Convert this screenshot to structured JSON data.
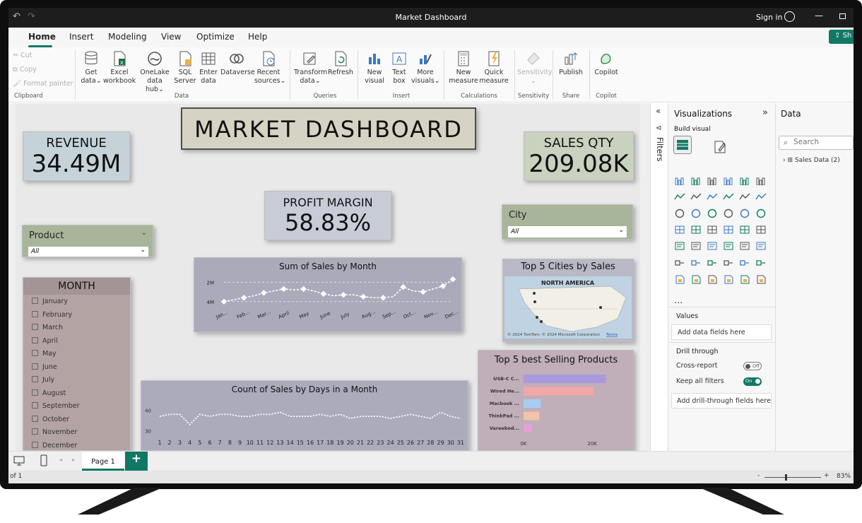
{
  "window": {
    "title": "Market Dashboard",
    "sign_in": "Sign in"
  },
  "menu": [
    "Home",
    "Insert",
    "Modeling",
    "View",
    "Optimize",
    "Help"
  ],
  "share_label": "Sh",
  "clipboard": {
    "cut": "Cut",
    "copy": "Copy",
    "format_painter": "Format painter",
    "group": "Clipboard"
  },
  "ribbon": {
    "get_data_1": "Get",
    "get_data_2": "data",
    "excel_1": "Excel",
    "excel_2": "workbook",
    "onelake_1": "OneLake",
    "onelake_2": "data hub",
    "sql_1": "SQL",
    "sql_2": "Server",
    "enter_1": "Enter",
    "enter_2": "data",
    "dataverse": "Dataverse",
    "recent_1": "Recent",
    "recent_2": "sources",
    "data_group": "Data",
    "transform_1": "Transform",
    "transform_2": "data",
    "refresh": "Refresh",
    "queries_group": "Queries",
    "new_visual_1": "New",
    "new_visual_2": "visual",
    "text_box_1": "Text",
    "text_box_2": "box",
    "more_visuals_1": "More",
    "more_visuals_2": "visuals",
    "insert_group": "Insert",
    "new_measure_1": "New",
    "new_measure_2": "measure",
    "quick_measure_1": "Quick",
    "quick_measure_2": "measure",
    "calculations_group": "Calculations",
    "sensitivity": "Sensitivity",
    "sensitivity_group": "Sensitivity",
    "publish": "Publish",
    "share_group": "Share",
    "copilot": "Copilot",
    "copilot_group": "Copilot"
  },
  "dashboard": {
    "title": "MARKET DASHBOARD",
    "revenue_label": "REVENUE",
    "revenue_value": "34.49M",
    "sales_qty_label": "SALES QTY",
    "sales_qty_value": "209.08K",
    "profit_label": "PROFIT MARGIN",
    "profit_value": "58.83%",
    "product_label": "Product",
    "product_value": "All",
    "city_label": "City",
    "city_value": "All",
    "month_label": "MONTH",
    "months": [
      "January",
      "February",
      "March",
      "April",
      "May",
      "June",
      "July",
      "August",
      "September",
      "October",
      "November",
      "December"
    ],
    "map_title": "Top 5 Cities by Sales",
    "map_region": "NORTH AMERICA",
    "map_credit": "© 2024 TomTom, © 2024 Microsoft Corporation",
    "map_terms": "Terms"
  },
  "chart_data": [
    {
      "type": "line",
      "title": "Sum of Sales by Month",
      "categories": [
        "Jan...",
        "Feb...",
        "Mar...",
        "April",
        "May",
        "June",
        "July",
        "Aug...",
        "Sep...",
        "Oct...",
        "Nov...",
        "Dec..."
      ],
      "x": [
        1,
        2,
        3,
        4,
        5,
        6,
        7,
        8,
        9,
        10,
        11,
        12,
        13,
        14,
        15,
        16,
        17,
        18,
        19,
        20,
        21,
        22,
        23,
        24
      ],
      "values": [
        2.0,
        2.2,
        2.4,
        2.6,
        2.9,
        3.1,
        3.3,
        3.2,
        3.3,
        3.1,
        2.8,
        2.6,
        2.7,
        2.7,
        2.5,
        2.4,
        2.4,
        2.5,
        3.5,
        3.1,
        3.0,
        3.3,
        3.6,
        4.3
      ],
      "yticks": [
        "2M",
        "4M"
      ],
      "ylim": [
        1.4,
        4.6
      ]
    },
    {
      "type": "line",
      "title": "Count of Sales by Days in a Month",
      "x": [
        1,
        2,
        3,
        4,
        5,
        6,
        7,
        8,
        9,
        10,
        11,
        12,
        13,
        14,
        15,
        16,
        17,
        18,
        19,
        20,
        21,
        22,
        23,
        24,
        25,
        26,
        27,
        28,
        29,
        30,
        31
      ],
      "values": [
        37,
        38,
        38,
        33,
        38,
        37,
        38,
        38,
        37,
        37,
        38,
        38,
        39,
        37,
        37,
        37,
        38,
        37,
        38,
        36,
        37,
        37,
        37,
        36,
        37,
        38,
        37,
        36,
        39,
        37,
        36
      ],
      "yticks": [
        "30",
        "40"
      ],
      "ylim": [
        28,
        44
      ]
    },
    {
      "type": "bar",
      "title": "Top 5 best Selling Products",
      "categories": [
        "USB-C C...",
        "Wired He...",
        "Macbook ...",
        "ThinkPad ...",
        "Vareebod..."
      ],
      "values": [
        24000,
        20500,
        5000,
        4600,
        2400
      ],
      "colors": [
        "#a99ae0",
        "#f2a7a7",
        "#a7cdf2",
        "#f2c3a9",
        "#e8a0d8"
      ],
      "xticks": [
        "0K",
        "20K"
      ],
      "xlim": [
        0,
        28000
      ]
    }
  ],
  "filters_label": "Filters",
  "visualizations": {
    "title": "Visualizations",
    "build_visual": "Build visual",
    "values_label": "Values",
    "values_placeholder": "Add data fields here",
    "drill_through": "Drill through",
    "cross_report": "Cross-report",
    "cross_report_state": "Off",
    "keep_filters": "Keep all filters",
    "keep_filters_state": "On",
    "drill_placeholder": "Add drill-through fields here",
    "more": "..."
  },
  "data_pane": {
    "title": "Data",
    "search_placeholder": "Search",
    "table": "Sales Data (2)"
  },
  "tabs": {
    "page1": "Page 1"
  },
  "status": {
    "left": "of 1",
    "zoom": "83%"
  },
  "colors": {
    "accent": "#117865",
    "kpi_blue": "#c5d3d8",
    "kpi_green": "#c9d1bf",
    "filter_green": "#a8b59b",
    "month_rose": "#b3a3a3"
  }
}
